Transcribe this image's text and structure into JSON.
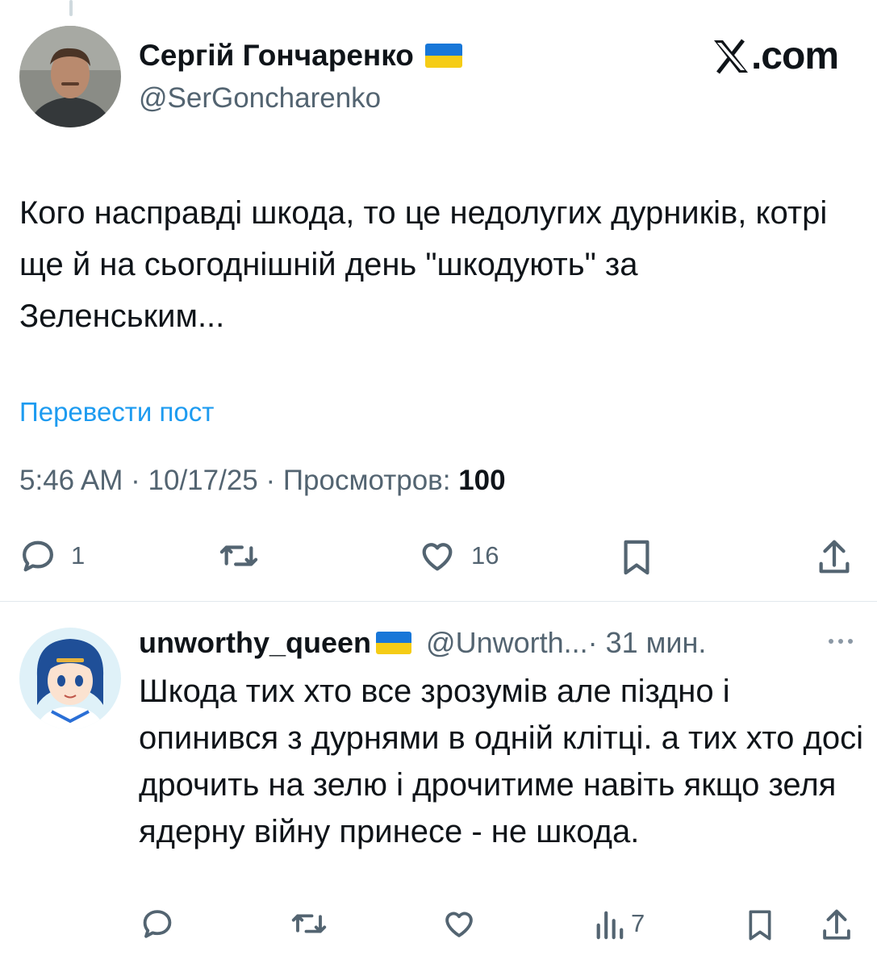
{
  "post": {
    "author_name": "Сергій Гончаренко",
    "author_handle": "@SerGoncharenko",
    "brand": ".com",
    "text": "Кого насправді шкода, то це недолугих дурників, котрі ще й на сьогоднішній день \"шкодують\" за Зеленським...",
    "translate_label": "Перевести пост",
    "meta_prefix": "5:46 AM · 10/17/25 · Просмотров: ",
    "views": "100",
    "actions": {
      "reply_count": "1",
      "retweet_count": "",
      "like_count": "16"
    }
  },
  "reply": {
    "author_name": "unworthy_queen",
    "author_handle": "@Unworth...",
    "time": " · 31 мин.",
    "text": "Шкода тих хто все зрозумів але піздно і опинився з дурнями в одній клітці. а тих хто досі дрочить на зелю і дрочитиме навіть якщо зеля ядерну війну принесе - не шкода.",
    "actions": {
      "views_count": "7"
    }
  },
  "colors": {
    "accent": "#1d9bf0",
    "secondary_text": "#536471",
    "flag_blue": "#1877d8",
    "flag_yellow": "#f5cc16"
  },
  "icons": [
    "reply-icon",
    "retweet-icon",
    "like-icon",
    "bookmark-icon",
    "share-icon",
    "views-icon",
    "more-icon",
    "x-logo-icon",
    "ukraine-flag-icon"
  ]
}
